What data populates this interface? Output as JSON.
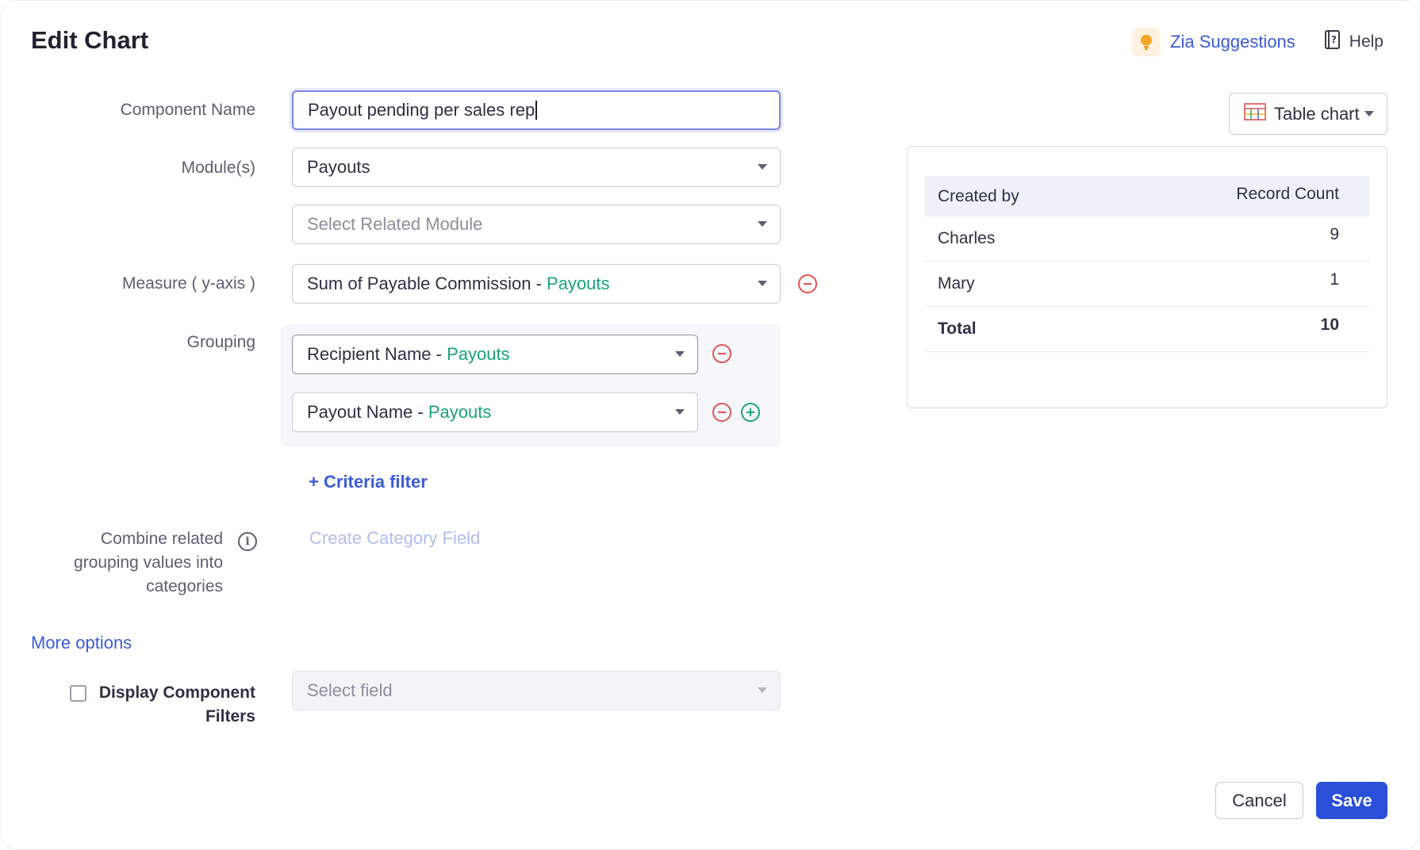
{
  "header": {
    "title": "Edit Chart",
    "zia_label": "Zia Suggestions",
    "help_label": "Help"
  },
  "form": {
    "component_name": {
      "label": "Component Name",
      "value": "Payout pending per sales rep"
    },
    "modules": {
      "label": "Module(s)",
      "value": "Payouts"
    },
    "related_module": {
      "placeholder": "Select Related Module"
    },
    "measure": {
      "label": "Measure ( y-axis )",
      "value": "Sum of Payable Commission",
      "module": "Payouts"
    },
    "grouping": {
      "label": "Grouping",
      "items": [
        {
          "field": "Recipient Name",
          "module": "Payouts"
        },
        {
          "field": "Payout Name",
          "module": "Payouts"
        }
      ]
    },
    "criteria_filter": "+ Criteria filter",
    "category": {
      "label_lines": [
        "Combine related",
        "grouping values into",
        "categories"
      ],
      "link": "Create Category Field"
    },
    "more_options": "More options",
    "display_filters": {
      "label_lines": [
        "Display Component",
        "Filters"
      ],
      "placeholder": "Select field",
      "checked": false
    }
  },
  "preview": {
    "chart_type": "Table chart",
    "columns": [
      "Created by",
      "Record Count"
    ],
    "rows": [
      {
        "name": "Charles",
        "count": "9"
      },
      {
        "name": "Mary",
        "count": "1"
      }
    ],
    "total": {
      "name": "Total",
      "count": "10"
    }
  },
  "footer": {
    "cancel": "Cancel",
    "save": "Save"
  },
  "colors": {
    "accent_blue": "#3b5bdb",
    "module_green": "#1aa37a",
    "remove_red": "#e05252",
    "save_button": "#2a4fd8"
  }
}
